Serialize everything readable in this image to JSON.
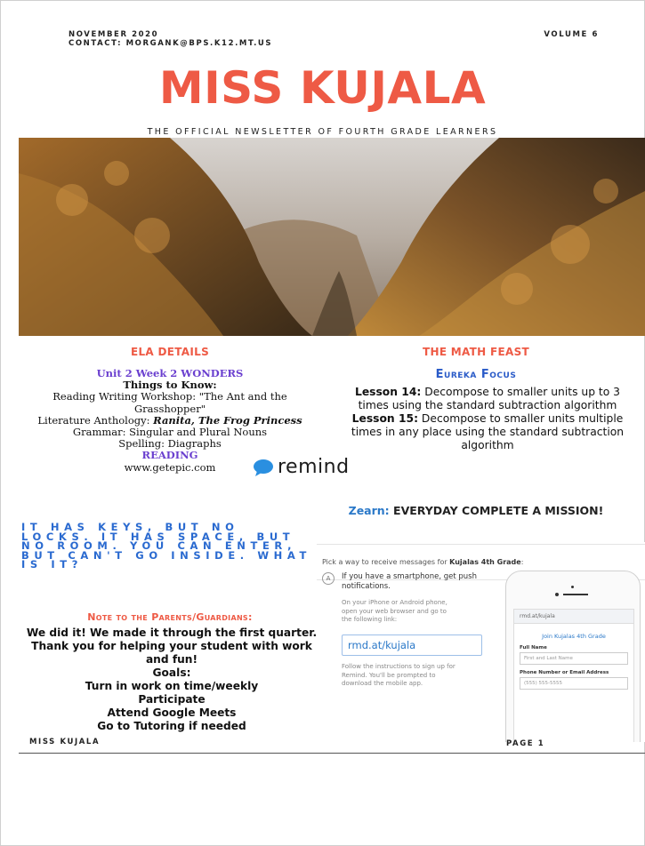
{
  "header": {
    "date": "NOVEMBER 2020",
    "contact": "CONTACT: MORGANK@BPS.K12.MT.US",
    "volume": "VOLUME 6"
  },
  "title": "MISS KUJALA",
  "subtitle": "THE OFFICIAL NEWSLETTER OF FOURTH GRADE LEARNERS",
  "ela": {
    "heading": "ELA DETAILS",
    "unit": "Unit 2 Week  2 WONDERS",
    "things": "Things to Know:",
    "workshop": "Reading Writing Workshop: \"The Ant and the Grasshopper\"",
    "anthology_label": "Literature Anthology: ",
    "anthology_title": "Ranita, The Frog Princess",
    "grammar": "Grammar: Singular and Plural Nouns",
    "spelling": "Spelling: Diagraphs",
    "reading": "READING",
    "site": "www.getepic.com"
  },
  "remind_logo": "remind",
  "math": {
    "heading": "THE MATH FEAST",
    "eureka": "Eureka Focus",
    "lesson14_label": "Lesson  14:",
    "lesson14_text": " Decompose to smaller units up to 3 times using the standard subtraction algorithm",
    "lesson15_label": "Lesson 15:",
    "lesson15_text": " Decompose to smaller units multiple times in any place using the standard subtraction algorithm"
  },
  "zearn": {
    "label": "Zearn:",
    "text": " EVERYDAY COMPLETE A MISSION!"
  },
  "riddle": "IT HAS KEYS, BUT NO LOCKS. IT HAS SPACE, BUT NO ROOM. YOU CAN ENTER, BUT CAN'T GO INSIDE. WHAT IS IT?",
  "remind_card": {
    "pick_prefix": "Pick a way to receive messages for ",
    "pick_class": "Kujalas 4th Grade",
    "pick_suffix": ":",
    "step": "A",
    "headline": "If you have a smartphone, get push notifications.",
    "instructions": "On your iPhone or Android phone, open your web browser and go to the following link:",
    "link": "rmd.at/kujala",
    "follow": "Follow the instructions to sign up for Remind. You'll be prompted to download the mobile app.",
    "phone": {
      "url": "rmd.at/kujala",
      "join": "Join Kujalas 4th Grade",
      "full_name_label": "Full Name",
      "full_name_placeholder": "First and Last Name",
      "contact_label": "Phone Number or Email Address",
      "contact_placeholder": "(555) 555-5555"
    }
  },
  "note": {
    "heading": "Note to the Parents/Guardians:",
    "line1": "We did it! We made it through the first quarter.",
    "line2": "Thank you for helping your student with work and fun!",
    "goals": "Goals:",
    "goal1": "Turn in work on time/weekly",
    "goal2": "Participate",
    "goal3": "Attend Google Meets",
    "goal4": "Go to Tutoring if needed"
  },
  "footer": {
    "left": "MISS KUJALA",
    "right": "PAGE 1"
  },
  "colors": {
    "title": "#ee5a45",
    "purple": "#6a3fcf",
    "blue": "#2a78c8",
    "riddle": "#2a6ad0"
  }
}
